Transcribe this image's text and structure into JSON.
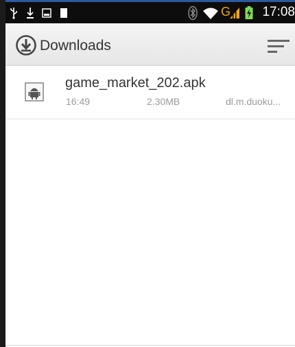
{
  "status_bar": {
    "time": "17:08",
    "icons": [
      "usb-icon",
      "download-icon",
      "image-icon",
      "battery-small-icon",
      "bluetooth-icon",
      "wifi-icon",
      "network-g-icon",
      "signal-icon",
      "battery-charging-icon"
    ],
    "network_type": "G",
    "colors": {
      "background": "#0d0d0d",
      "accent": "#2c5aa0",
      "signal": "#f2a51a",
      "battery": "#7ed957"
    }
  },
  "action_bar": {
    "title": "Downloads",
    "home_icon": "download-circle-icon",
    "menu_icon": "sort-icon"
  },
  "downloads": [
    {
      "icon": "android-apk-icon",
      "name": "game_market_202.apk",
      "time": "16:49",
      "size": "2.30MB",
      "source": "dl.m.duoku..."
    }
  ]
}
